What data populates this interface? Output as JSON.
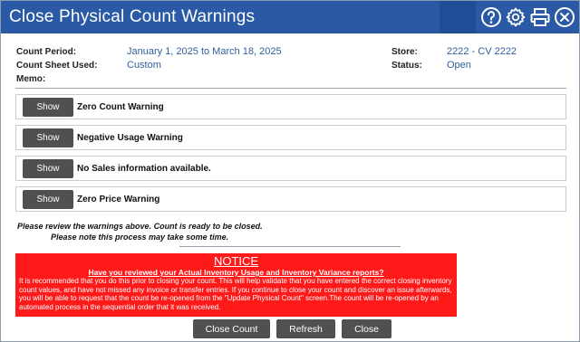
{
  "window": {
    "title": "Close Physical Count Warnings"
  },
  "header_icons": [
    "help-icon",
    "gear-icon",
    "print-icon",
    "close-icon"
  ],
  "details": {
    "count_period_label": "Count Period:",
    "count_period_value": "January 1, 2025 to March 18, 2025",
    "count_sheet_label": "Count Sheet Used:",
    "count_sheet_value": "Custom",
    "memo_label": "Memo:",
    "store_label": "Store:",
    "store_value": "2222 - CV 2222",
    "status_label": "Status:",
    "status_value": "Open"
  },
  "warnings": [
    {
      "button": "Show",
      "text": "Zero Count Warning"
    },
    {
      "button": "Show",
      "text": "Negative Usage Warning"
    },
    {
      "button": "Show",
      "text": "No Sales information available."
    },
    {
      "button": "Show",
      "text": "Zero Price Warning"
    }
  ],
  "review_note": {
    "line1": "Please review the warnings above. Count is ready to be closed.",
    "line2": "Please note this process may take some time."
  },
  "notice": {
    "title": "NOTICE",
    "question": "Have you reviewed your Actual Inventory Usage and Inventory Variance reports?",
    "body": "It is recommended that you do this prior to closing your count. This will help validate that you have entered the correct closing inventory count values, and have not missed any invoice or transfer entries. If you continue to close your count and discover an issue afterwards, you will be able to request that the count be re-opened from the \"Update Physical Count\" screen.The count will be re-opened by an automated process in the sequential order that it was received."
  },
  "actions": {
    "close_count": "Close Count",
    "refresh": "Refresh",
    "close": "Close"
  },
  "colors": {
    "title_bar": "#2a5aa6",
    "value_text": "#2f5f9e",
    "button": "#505050",
    "notice": "#ff1a1a"
  }
}
